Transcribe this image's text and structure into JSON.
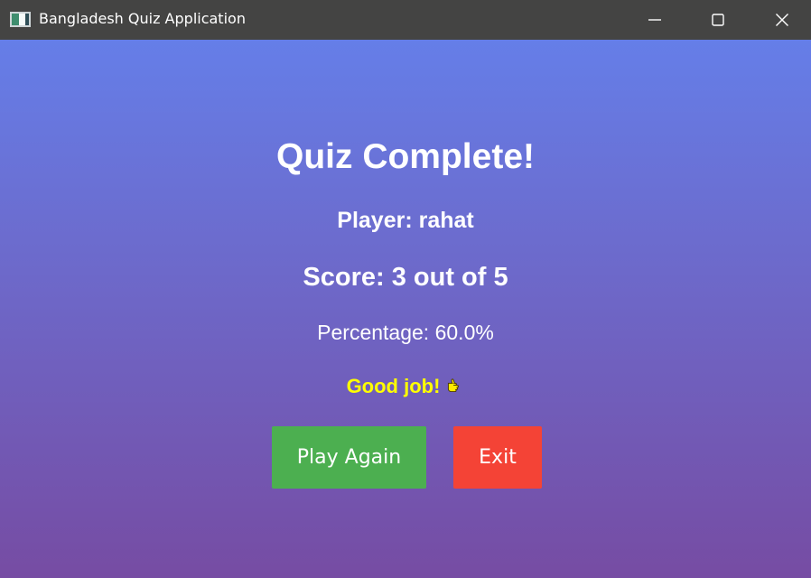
{
  "window": {
    "title": "Bangladesh Quiz Application",
    "icon": "app-window-icon",
    "controls": {
      "minimize_icon": "minimize-icon",
      "maximize_icon": "maximize-icon",
      "close_icon": "close-icon"
    }
  },
  "results": {
    "heading": "Quiz Complete!",
    "player_text": "Player: rahat",
    "score_text": "Score: 3 out of 5",
    "percentage_text": "Percentage: 60.0%",
    "feedback_text": "Good job!",
    "feedback_icon": "pointing-hand-icon"
  },
  "actions": {
    "play_again_label": "Play Again",
    "exit_label": "Exit"
  },
  "colors": {
    "titlebar": "#444443",
    "gradient_top": "#657ee8",
    "gradient_bottom": "#764ca3",
    "feedback_text": "#ffff00",
    "play_again": "#4caf50",
    "exit": "#f44336"
  }
}
